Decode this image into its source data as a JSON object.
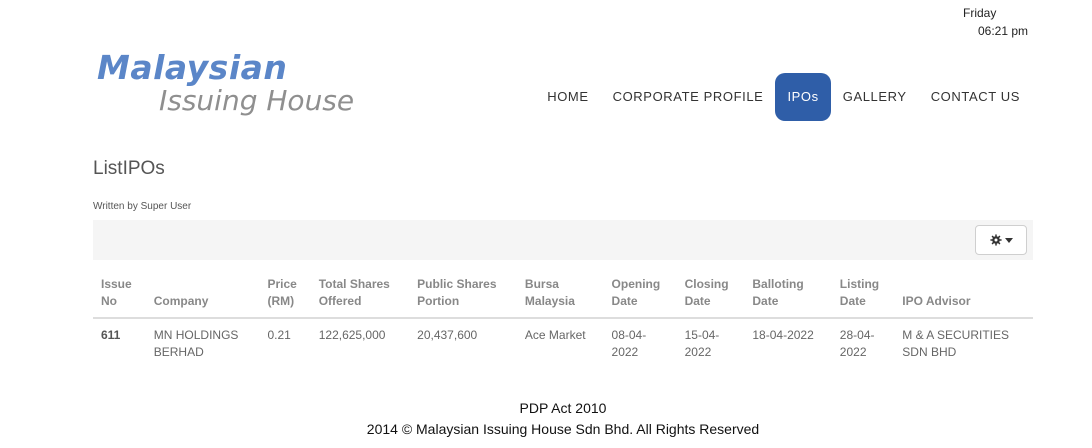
{
  "clock": {
    "day": "Friday",
    "time": "06:21 pm"
  },
  "logo": {
    "line1": "Malaysian",
    "line2": "Issuing House"
  },
  "nav": {
    "items": [
      {
        "label": "HOME"
      },
      {
        "label": "CORPORATE PROFILE"
      },
      {
        "label": "IPOs"
      },
      {
        "label": "GALLERY"
      },
      {
        "label": "CONTACT US"
      }
    ],
    "active": "IPOs",
    "active_color": "#2f5ea8"
  },
  "article": {
    "title": "ListIPOs",
    "written_by": "Written by Super User"
  },
  "toolbar": {
    "settings_icon": "gear-icon"
  },
  "table": {
    "headers": [
      [
        "Issue",
        "No"
      ],
      [
        "Company"
      ],
      [
        "Price",
        "(RM)"
      ],
      [
        "Total Shares",
        "Offered"
      ],
      [
        "Public Shares",
        "Portion"
      ],
      [
        "Bursa",
        "Malaysia"
      ],
      [
        "Opening",
        "Date"
      ],
      [
        "Closing",
        "Date"
      ],
      [
        "Balloting",
        "Date"
      ],
      [
        "Listing",
        "Date"
      ],
      [
        "IPO Advisor"
      ]
    ],
    "rows": [
      [
        [
          "611"
        ],
        [
          "MN HOLDINGS",
          "BERHAD"
        ],
        [
          "0.21"
        ],
        [
          "122,625,000"
        ],
        [
          "20,437,600"
        ],
        [
          "Ace Market"
        ],
        [
          "08-04-",
          "2022"
        ],
        [
          "15-04-",
          "2022"
        ],
        [
          "18-04-2022"
        ],
        [
          "28-04-",
          "2022"
        ],
        [
          "M & A SECURITIES",
          "SDN BHD"
        ]
      ]
    ]
  },
  "footer": {
    "line1": "PDP Act 2010",
    "line2": "2014 © Malaysian Issuing House Sdn Bhd. All Rights Reserved"
  }
}
